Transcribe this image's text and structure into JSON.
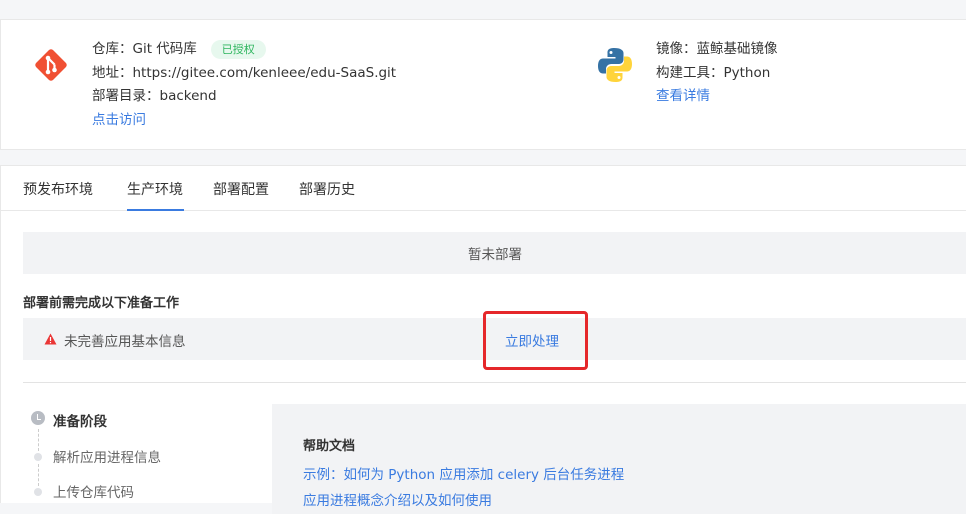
{
  "repo": {
    "repo_label": "仓库：Git 代码库",
    "badge": "已授权",
    "address": "地址：https://gitee.com/kenleee/edu-SaaS.git",
    "deploy_dir": "部署目录：backend",
    "visit_link": "点击访问"
  },
  "image": {
    "mirror": "镜像：蓝鲸基础镜像",
    "build_tool": "构建工具：Python",
    "details_link": "查看详情"
  },
  "tabs": [
    {
      "label": "预发布环境"
    },
    {
      "label": "生产环境",
      "active": true
    },
    {
      "label": "部署配置"
    },
    {
      "label": "部署历史"
    }
  ],
  "deploy": {
    "status": "暂未部署",
    "prep_title": "部署前需完成以下准备工作",
    "todo_text": "未完善应用基本信息",
    "todo_action": "立即处理"
  },
  "steps": {
    "stage_title": "准备阶段",
    "items": [
      {
        "label": "解析应用进程信息"
      },
      {
        "label": "上传仓库代码"
      }
    ]
  },
  "help": {
    "title": "帮助文档",
    "links": [
      {
        "label": "示例：如何为 Python 应用添加 celery 后台任务进程"
      },
      {
        "label": "应用进程概念介绍以及如何使用"
      }
    ]
  },
  "colors": {
    "accent": "#3a7be0",
    "badge_green": "#2db55d",
    "highlight_red": "#e5272a",
    "warning_red": "#ea3636",
    "git_orange": "#f05033"
  }
}
